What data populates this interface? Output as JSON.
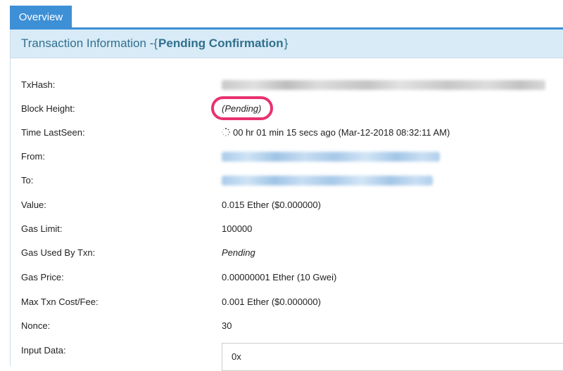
{
  "tabs": [
    {
      "label": "Overview",
      "active": true
    }
  ],
  "header": {
    "prefix": "Transaction Information - ",
    "open_brace": "{",
    "status": "Pending Confirmation",
    "close_brace": "}"
  },
  "rows": {
    "txhash": {
      "label": "TxHash:"
    },
    "block_height": {
      "label": "Block Height:",
      "value": "(Pending)"
    },
    "time_lastseen": {
      "label": "Time LastSeen:",
      "value": "00 hr 01 min 15 secs ago (Mar-12-2018 08:32:11 AM)"
    },
    "from": {
      "label": "From:"
    },
    "to": {
      "label": "To:"
    },
    "value": {
      "label": "Value:",
      "value": "0.015 Ether ($0.000000)"
    },
    "gas_limit": {
      "label": "Gas Limit:",
      "value": "100000"
    },
    "gas_used": {
      "label": "Gas Used By Txn:",
      "value": "Pending"
    },
    "gas_price": {
      "label": "Gas Price:",
      "value": "0.00000001 Ether (10 Gwei)"
    },
    "max_fee": {
      "label": "Max Txn Cost/Fee:",
      "value": "0.001 Ether ($0.000000)"
    },
    "nonce": {
      "label": "Nonce:",
      "value": "30"
    },
    "input_data": {
      "label": "Input Data:",
      "value": "0x"
    }
  },
  "colors": {
    "tab_blue": "#3d8fd6",
    "header_bg": "#d8ebf6",
    "header_text": "#31708f",
    "highlight": "#e8326f"
  }
}
